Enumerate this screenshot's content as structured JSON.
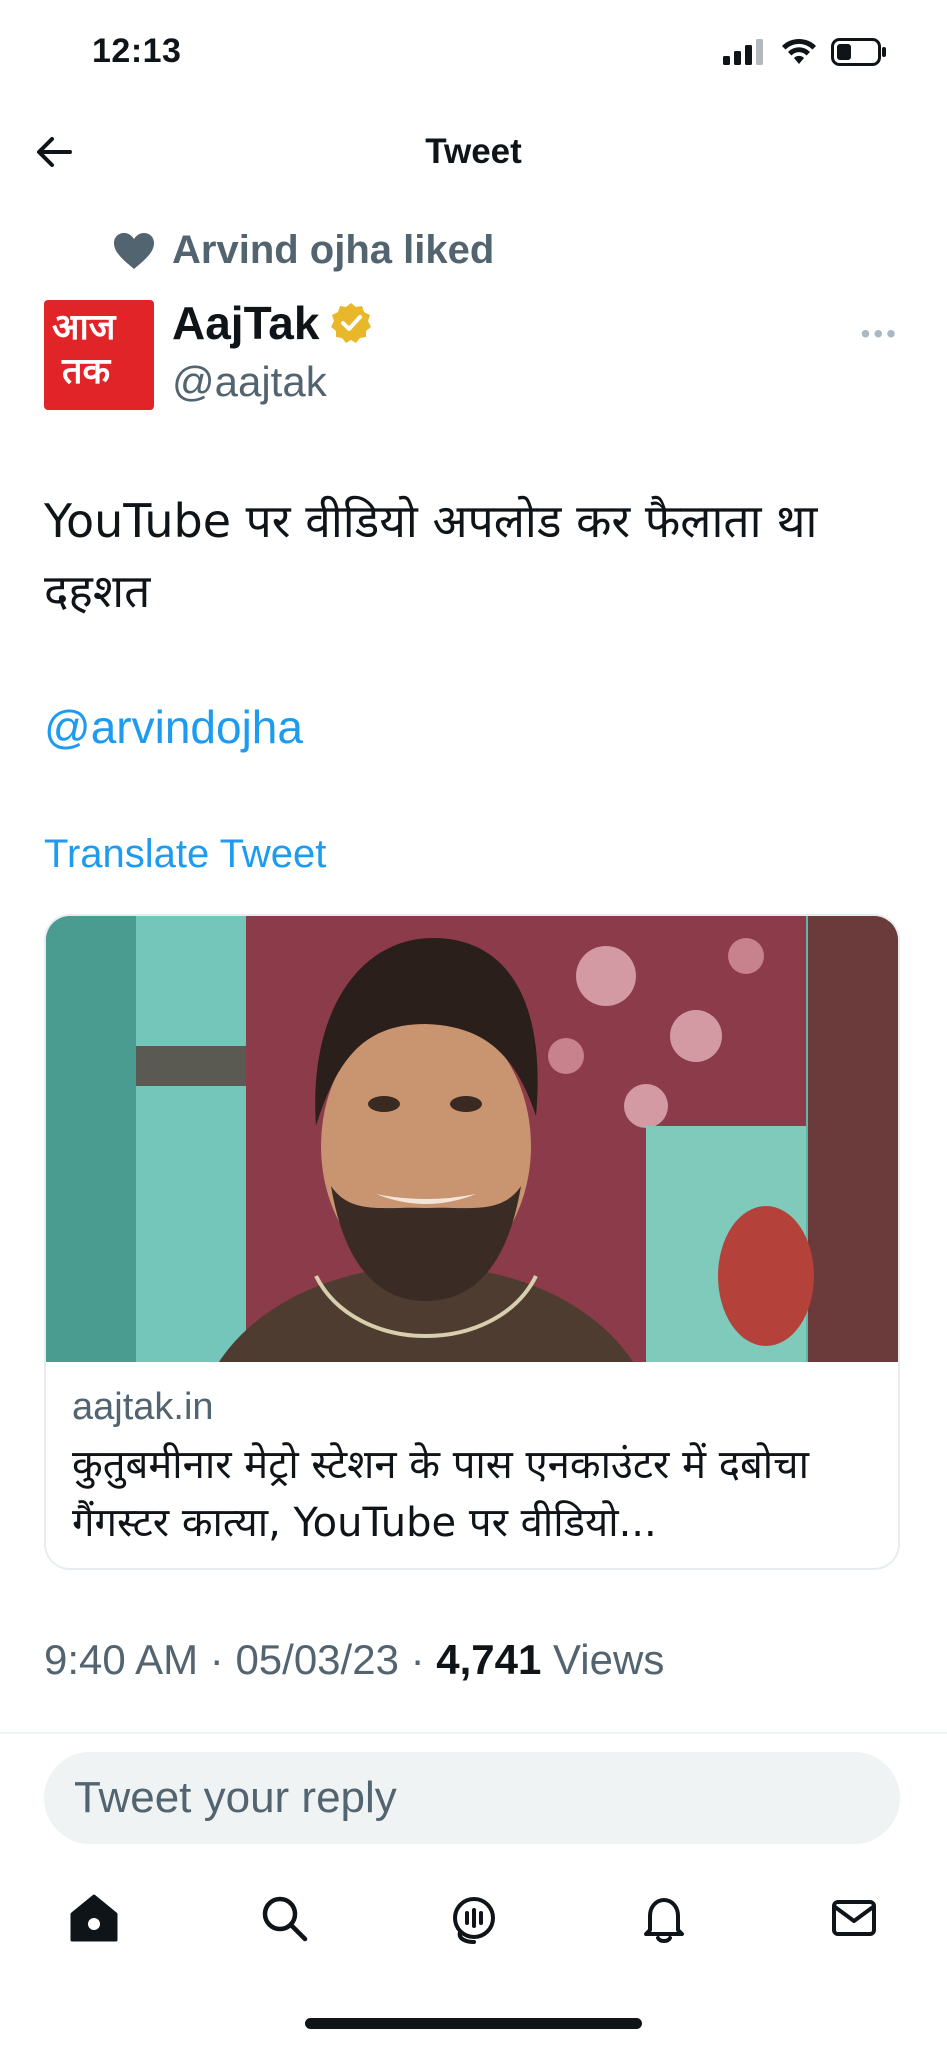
{
  "status_bar": {
    "time": "12:13"
  },
  "header": {
    "title": "Tweet"
  },
  "social_context": {
    "text": "Arvind ojha liked"
  },
  "author": {
    "avatar_text_top": "आज",
    "avatar_text_bottom": "तक",
    "display_name": "AajTak",
    "handle": "@aajtak",
    "verified": true
  },
  "tweet": {
    "text": "YouTube पर वीडियो अपलोड कर फैलाता था दहशत",
    "mention": "@arvindojha",
    "translate_label": "Translate Tweet"
  },
  "link_card": {
    "domain": "aajtak.in",
    "title": "कुतुबमीनार मेट्रो स्टेशन के पास एनकाउंटर में दबोचा गैंगस्टर कात्या, YouTube पर वीडियो..."
  },
  "meta": {
    "time": "9:40 AM",
    "date": "05/03/23",
    "views_count": "4,741",
    "views_label": "Views"
  },
  "reply": {
    "placeholder": "Tweet your reply"
  },
  "colors": {
    "accent": "#1d9bf0",
    "muted": "#536471",
    "verified": "#e8b82a",
    "brand_red": "#e02427"
  },
  "nav_icons": [
    "home-icon",
    "search-icon",
    "spaces-icon",
    "notifications-icon",
    "messages-icon"
  ]
}
